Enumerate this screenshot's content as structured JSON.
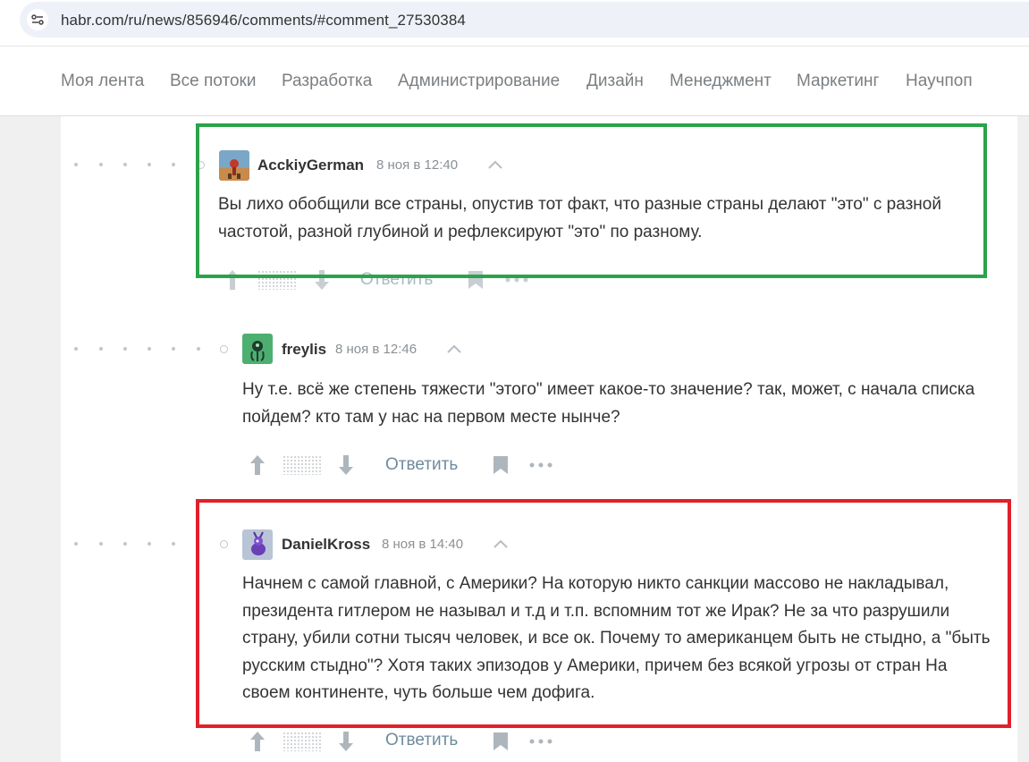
{
  "browser": {
    "url": "habr.com/ru/news/856946/comments/#comment_27530384"
  },
  "nav": {
    "items": [
      "Моя лента",
      "Все потоки",
      "Разработка",
      "Администрирование",
      "Дизайн",
      "Менеджмент",
      "Маркетинг",
      "Научпоп"
    ]
  },
  "comments": [
    {
      "author": "AcckiyGerman",
      "time": "8 ноя в 12:40",
      "text": "Вы лихо обобщили все страны, опустив тот факт, что разные страны делают \"это\" с разной частотой, разной глубиной и рефлексируют \"это\" по разному.",
      "reply_label": "Ответить"
    },
    {
      "author": "freylis",
      "time": "8 ноя в 12:46",
      "text": "Ну т.е. всё же степень тяжести \"этого\" имеет какое-то значение? так, может, с начала списка пойдем? кто там у нас на первом месте нынче?",
      "reply_label": "Ответить"
    },
    {
      "author": "DanielKross",
      "time": "8 ноя в 14:40",
      "text": "Начнем с самой главной, с Америки? На которую никто санкции массово не накладывал, президента гитлером не называл и т.д и т.п. вспомним тот же Ирак? Не за что разрушили страну, убили сотни тысяч человек, и все ок. Почему то американцем быть не стыдно, а \"быть русским стыдно\"? Хотя таких эпизодов у Америки, причем без всякой угрозы от стран На своем континенте, чуть больше чем дофига.",
      "reply_label": "Ответить"
    }
  ],
  "colors": {
    "highlight_green": "#2aa34a",
    "highlight_red": "#e0202a",
    "link": "#6f8b9c"
  }
}
